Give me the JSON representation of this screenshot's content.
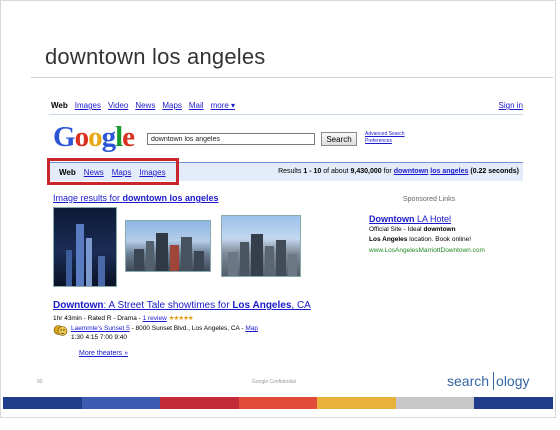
{
  "slide": {
    "title": "downtown los angeles",
    "slide_number": "90",
    "footer_confidential": "Google Confidential",
    "brand_left": "search",
    "brand_right": "ology",
    "stripe_colors": [
      "#1f3d8a",
      "#3c5bb0",
      "#c22a3a",
      "#e24a3a",
      "#e8b23a",
      "#c7c7c7",
      "#1f3d8a"
    ]
  },
  "serp": {
    "topnav": [
      "Web",
      "Images",
      "Video",
      "News",
      "Maps",
      "Mail",
      "more ▾"
    ],
    "sign_in": "Sign in",
    "logo_letters": [
      "G",
      "o",
      "o",
      "g",
      "l",
      "e"
    ],
    "search_query": "downtown los angeles",
    "search_button": "Search",
    "advanced_search": "Advanced Search",
    "preferences": "Preferences",
    "verticals": [
      "Web",
      "News",
      "Maps",
      "Images"
    ],
    "results_stats": {
      "prefix": "Results ",
      "range": "1 - 10",
      "of_about": " of about ",
      "total": "9,430,000",
      "for": " for ",
      "query_word1": "downtown",
      "query_word2": "los angeles",
      "time": "(0.22 seconds)"
    },
    "image_results": {
      "prefix": "Image results for ",
      "query": "downtown los angeles"
    },
    "sponsored_label": "Sponsored Links",
    "ad": {
      "title_bold": "Downtown",
      "title_rest": " LA Hotel",
      "line1_prefix": "Official Site - Ideal ",
      "line1_bold": "downtown",
      "line2_bold": "Los Angeles",
      "line2_rest": " location. Book online!",
      "url": "www.LosAngelesMarriottDowntown.com"
    },
    "movie": {
      "title_bold1": "Downtown",
      "title_mid": ": A Street Tale showtimes for ",
      "title_bold2": "Los Angeles",
      "title_end": ", CA",
      "meta": "1hr 43min - Rated R - Drama - ",
      "review": "1 review",
      "stars": "★★★★★",
      "theater_name": "Laemmle's Sunset 5",
      "theater_addr": " - 8000 Sunset Blvd., Los Angeles, CA - ",
      "map_link": "Map",
      "showtimes": "1:30  4:15  7:00  9:40",
      "more_theaters": "More theaters »"
    }
  }
}
